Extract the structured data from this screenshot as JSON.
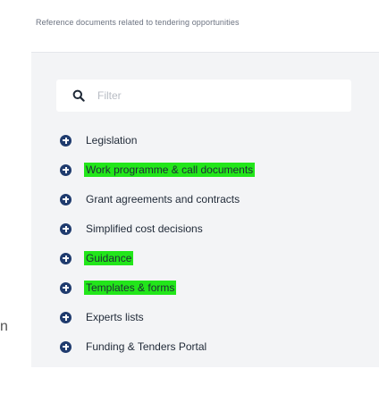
{
  "intro_text": "Reference documents related to tendering opportunities",
  "left_fragment": "n",
  "search": {
    "placeholder": "Filter",
    "value": ""
  },
  "nav": {
    "items": [
      {
        "label": "Legislation",
        "highlighted": false
      },
      {
        "label": "Work programme & call documents",
        "highlighted": true
      },
      {
        "label": "Grant agreements and contracts",
        "highlighted": false
      },
      {
        "label": "Simplified cost decisions",
        "highlighted": false
      },
      {
        "label": "Guidance",
        "highlighted": true
      },
      {
        "label": "Templates & forms",
        "highlighted": true
      },
      {
        "label": "Experts lists",
        "highlighted": false
      },
      {
        "label": "Funding & Tenders Portal",
        "highlighted": false
      }
    ]
  },
  "colors": {
    "highlight": "#22e61a",
    "icon": "#1f3b6e",
    "panel": "#f3f4f6"
  }
}
